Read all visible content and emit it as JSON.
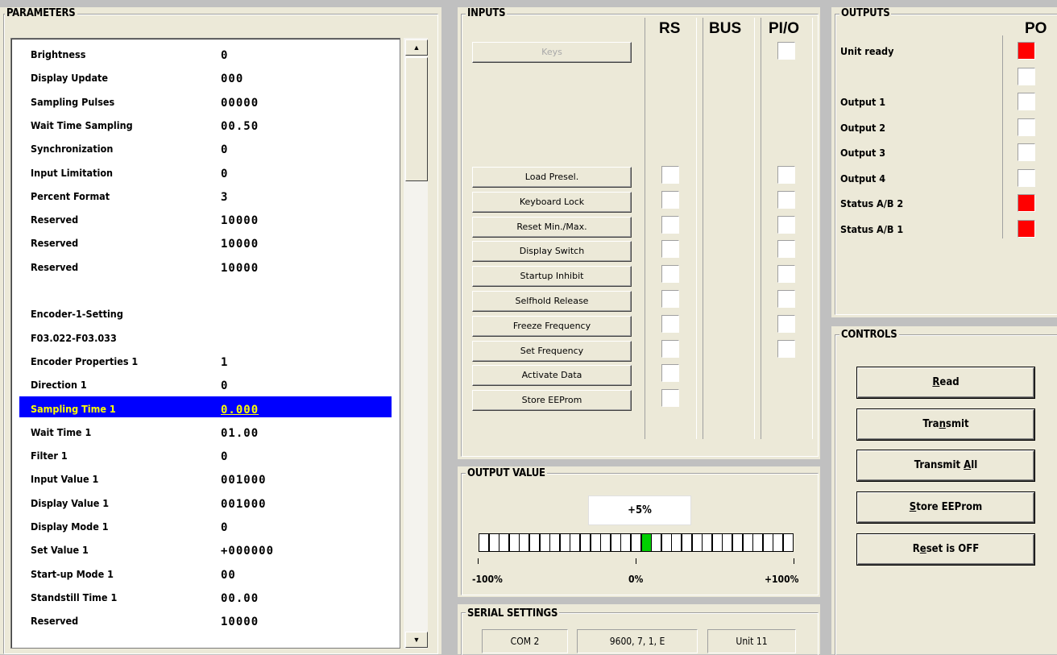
{
  "parameters": {
    "title": "PARAMETERS",
    "rows": [
      {
        "name": "Brightness",
        "value": "0"
      },
      {
        "name": "Display Update",
        "value": "000"
      },
      {
        "name": "Sampling Pulses",
        "value": "00000"
      },
      {
        "name": "Wait Time Sampling",
        "value": "00.50"
      },
      {
        "name": "Synchronization",
        "value": "0"
      },
      {
        "name": "Input Limitation",
        "value": "0"
      },
      {
        "name": "Percent Format",
        "value": "3"
      },
      {
        "name": "Reserved",
        "value": "10000"
      },
      {
        "name": "Reserved",
        "value": "10000"
      },
      {
        "name": "Reserved",
        "value": "10000"
      },
      {
        "name": "",
        "value": ""
      },
      {
        "name": "Encoder-1-Setting",
        "value": ""
      },
      {
        "name": "F03.022-F03.033",
        "value": ""
      },
      {
        "name": "Encoder Properties 1",
        "value": "1"
      },
      {
        "name": "Direction 1",
        "value": "0"
      },
      {
        "name": "Sampling Time 1",
        "value": "0.000",
        "selected": true
      },
      {
        "name": "Wait Time 1",
        "value": "01.00"
      },
      {
        "name": "Filter 1",
        "value": "0"
      },
      {
        "name": "Input Value 1",
        "value": "001000"
      },
      {
        "name": "Display Value 1",
        "value": "001000"
      },
      {
        "name": "Display Mode 1",
        "value": "0"
      },
      {
        "name": "Set Value 1",
        "value": "+000000"
      },
      {
        "name": "Start-up Mode 1",
        "value": "00"
      },
      {
        "name": "Standstill Time 1",
        "value": "00.00"
      },
      {
        "name": "Reserved",
        "value": "10000"
      }
    ],
    "scroll_up_icon": "arrow-up-icon",
    "scroll_down_icon": "arrow-down-icon"
  },
  "inputs": {
    "title": "INPUTS",
    "columns": [
      "RS",
      "BUS",
      "PI/O"
    ],
    "keys_button": "Keys",
    "buttons": [
      "Load Presel.",
      "Keyboard Lock",
      "Reset Min./Max.",
      "Display Switch",
      "Startup Inhibit",
      "Selfhold Release",
      "Freeze Frequency",
      "Set Frequency",
      "Activate Data",
      "Store EEProm"
    ]
  },
  "outputs": {
    "title": "OUTPUTS",
    "column": "PO",
    "items": [
      {
        "label": "Unit ready",
        "state": "red"
      },
      {
        "label": "",
        "state": "white"
      },
      {
        "label": "Output 1",
        "state": "white"
      },
      {
        "label": "Output 2",
        "state": "white"
      },
      {
        "label": "Output 3",
        "state": "white"
      },
      {
        "label": "Output 4",
        "state": "white"
      },
      {
        "label": "Status A/B 2",
        "state": "red"
      },
      {
        "label": "Status A/B 1",
        "state": "red"
      }
    ],
    "active_color": "#ff0000"
  },
  "controls": {
    "title": "CONTROLS",
    "buttons": [
      {
        "pre": "",
        "key": "R",
        "post": "ead"
      },
      {
        "pre": "Tra",
        "key": "n",
        "post": "smit"
      },
      {
        "pre": "Transmit ",
        "key": "A",
        "post": "ll"
      },
      {
        "pre": "",
        "key": "S",
        "post": "tore EEProm"
      },
      {
        "pre": "R",
        "key": "e",
        "post": "set is OFF"
      }
    ]
  },
  "output_value": {
    "title": "OUTPUT VALUE",
    "display": "+5%",
    "percent": 5,
    "scale_min": "-100%",
    "scale_mid": "0%",
    "scale_max": "+100%",
    "bar_color": "#00d000"
  },
  "serial_settings": {
    "title": "SERIAL SETTINGS",
    "port": "COM 2",
    "params": "9600, 7, 1, E",
    "unit": "Unit 11"
  }
}
